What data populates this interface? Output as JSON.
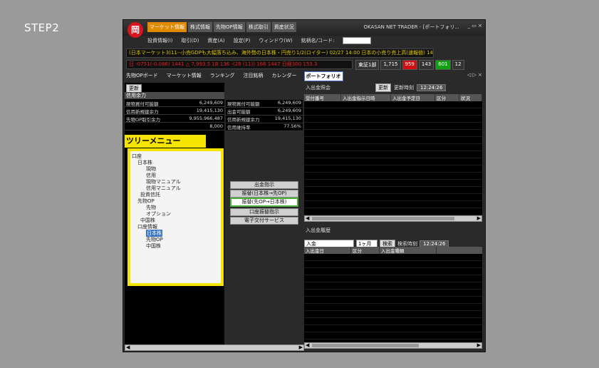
{
  "step_label": "STEP2",
  "app": {
    "logo_text": "岡",
    "top_tabs": [
      "マーケット情報",
      "株式情報",
      "先物OP情報",
      "株式取引",
      "資産状況"
    ],
    "window_title": "OKASAN NET TRADER - [ポートフォリ...",
    "window_controls": "_ ▭ ×"
  },
  "menu": {
    "items": [
      "投資情報(I)",
      "取引(D)",
      "資産(A)",
      "設定(P)",
      "ウィンドウ(W)",
      "銘柄名/コード:"
    ]
  },
  "tickers": {
    "line1": "(日本マーケット3)11--小売GDPも大幅落ち込み、海外勢の日本株・円売り1/2(ロイター) 02/27 14:00 日本の小売り売上高(速報値) 1447",
    "line2": "日 -0751(-0.086) 1441  △ 7,993.5  1B 136 -(28 (11)) 166 1447  日経300 153.3",
    "market_select": "東証1部",
    "stats": [
      "1,715",
      "959",
      "143",
      "601",
      "12"
    ]
  },
  "tabbar": {
    "items": [
      "先物OPボード",
      "マーケット情報",
      "ランキング",
      "注目銘柄",
      "カレンダー",
      "ポートフォリオ"
    ],
    "active_index": 5,
    "controls": "◁ ▷ ×"
  },
  "left": {
    "update": "更新",
    "header": "信用余力",
    "rows": [
      {
        "label": "現物買付可能額",
        "value": "6,249,609"
      },
      {
        "label": "信用新規建余力",
        "value": "19,415,130"
      },
      {
        "label": "先物OP取引余力",
        "value": "9,955,966,487"
      },
      {
        "label": "",
        "value": "8,000"
      }
    ]
  },
  "mid": {
    "rows": [
      {
        "label": "現物買付可能額",
        "value": "6,249,609"
      },
      {
        "label": "出金可能額",
        "value": "6,249,609"
      },
      {
        "label": "信用新規建余力",
        "value": "19,415,130"
      },
      {
        "label": "信用維持率",
        "value": "77.56%"
      }
    ],
    "buttons": [
      "出金指示",
      "振替(日本株→先OP)",
      "振替(先OP→日本株)",
      "口座振替指示",
      "電子交付サービス"
    ]
  },
  "tree": {
    "label": "ツリーメニュー",
    "items": [
      "口座",
      "日本株",
      "現物",
      "信用",
      "現物マニュアル",
      "信用マニュアル",
      "投資信託",
      "先物OP",
      "先物",
      "オプション",
      "中国株",
      "口座情報",
      "日本株",
      "先物OP",
      "中国株"
    ]
  },
  "right_top": {
    "title": "入出金照会",
    "update": "更新",
    "update_time_label": "更新時刻",
    "update_time": "12:24:26",
    "columns": [
      "受付番号",
      "入出金指示日時",
      "入出金予定日",
      "区分",
      "状況"
    ]
  },
  "right_bot": {
    "title": "入出金履歴",
    "type": "入金",
    "period": "1ヶ月",
    "search": "検索",
    "search_time_label": "検索時刻",
    "search_time": "12:24:26",
    "columns": [
      "入出金日",
      "区分",
      "入出金種類"
    ]
  }
}
